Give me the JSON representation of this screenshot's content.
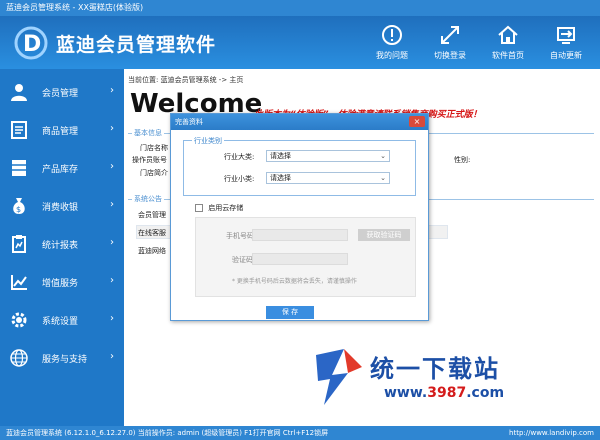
{
  "window": {
    "title": "蓝迪会员管理系统 - XX蛋糕店(体验版)"
  },
  "header": {
    "logo_text": "蓝迪会员管理软件",
    "buttons": [
      {
        "label": "我的问题"
      },
      {
        "label": "切换登录"
      },
      {
        "label": "软件首页"
      },
      {
        "label": "自动更新"
      }
    ]
  },
  "sidebar": {
    "items": [
      {
        "label": "会员管理",
        "arrow": "›"
      },
      {
        "label": "商品管理",
        "arrow": "›"
      },
      {
        "label": "产品库存",
        "arrow": "›"
      },
      {
        "label": "消费收银",
        "arrow": "›"
      },
      {
        "label": "统计报表",
        "arrow": "›"
      },
      {
        "label": "增值服务",
        "arrow": "›"
      },
      {
        "label": "系统设置",
        "arrow": "›"
      },
      {
        "label": "服务与支持",
        "arrow": "›"
      }
    ]
  },
  "main": {
    "breadcrumb": "当前位置: 蓝迪会员管理系统 -> 主页",
    "welcome": "Welcome",
    "notice": "此版本为“体验版”，体验满意请联系销售商购买正式版！",
    "section_basic": "基本信息",
    "store_name_label": "门店名称",
    "operator_label": "操作员账号",
    "store_intro_label": "门店简介",
    "gender_label": "性别:",
    "section_notice": "系统公告",
    "member_mgmt_label": "会员管理",
    "online_service_label": "在线客服",
    "landi_network_label": "蓝迪网络"
  },
  "dialog": {
    "title": "完善资料",
    "close": "×",
    "legend": "行业类别",
    "category_big_label": "行业大类:",
    "category_big_value": "请选择",
    "category_small_label": "行业小类:",
    "category_small_value": "请选择",
    "cloud_label": "启用云存储",
    "phone_label": "手机号码:",
    "get_code_btn": "获取验证码",
    "code_label": "验证码:",
    "hint": "* 更换手机号码后云数据将会丢失，请谨慎操作",
    "save": "保 存"
  },
  "status": {
    "text": "蓝迪会员管理系统 (6.12.1.0_6.12.27.0)   当前操作员: admin (超级管理员)   F1打开官网 Ctrl+F12锁屏",
    "url": "http://www.landivip.com"
  },
  "watermark": {
    "text": "统一下载站",
    "url_prefix": "www.",
    "url_red": "3987",
    "url_suffix": ".com"
  },
  "colors": {
    "brand_blue": "#1f78c8",
    "notice_red": "#d61515",
    "dialog_accent": "#3a8ee0"
  }
}
